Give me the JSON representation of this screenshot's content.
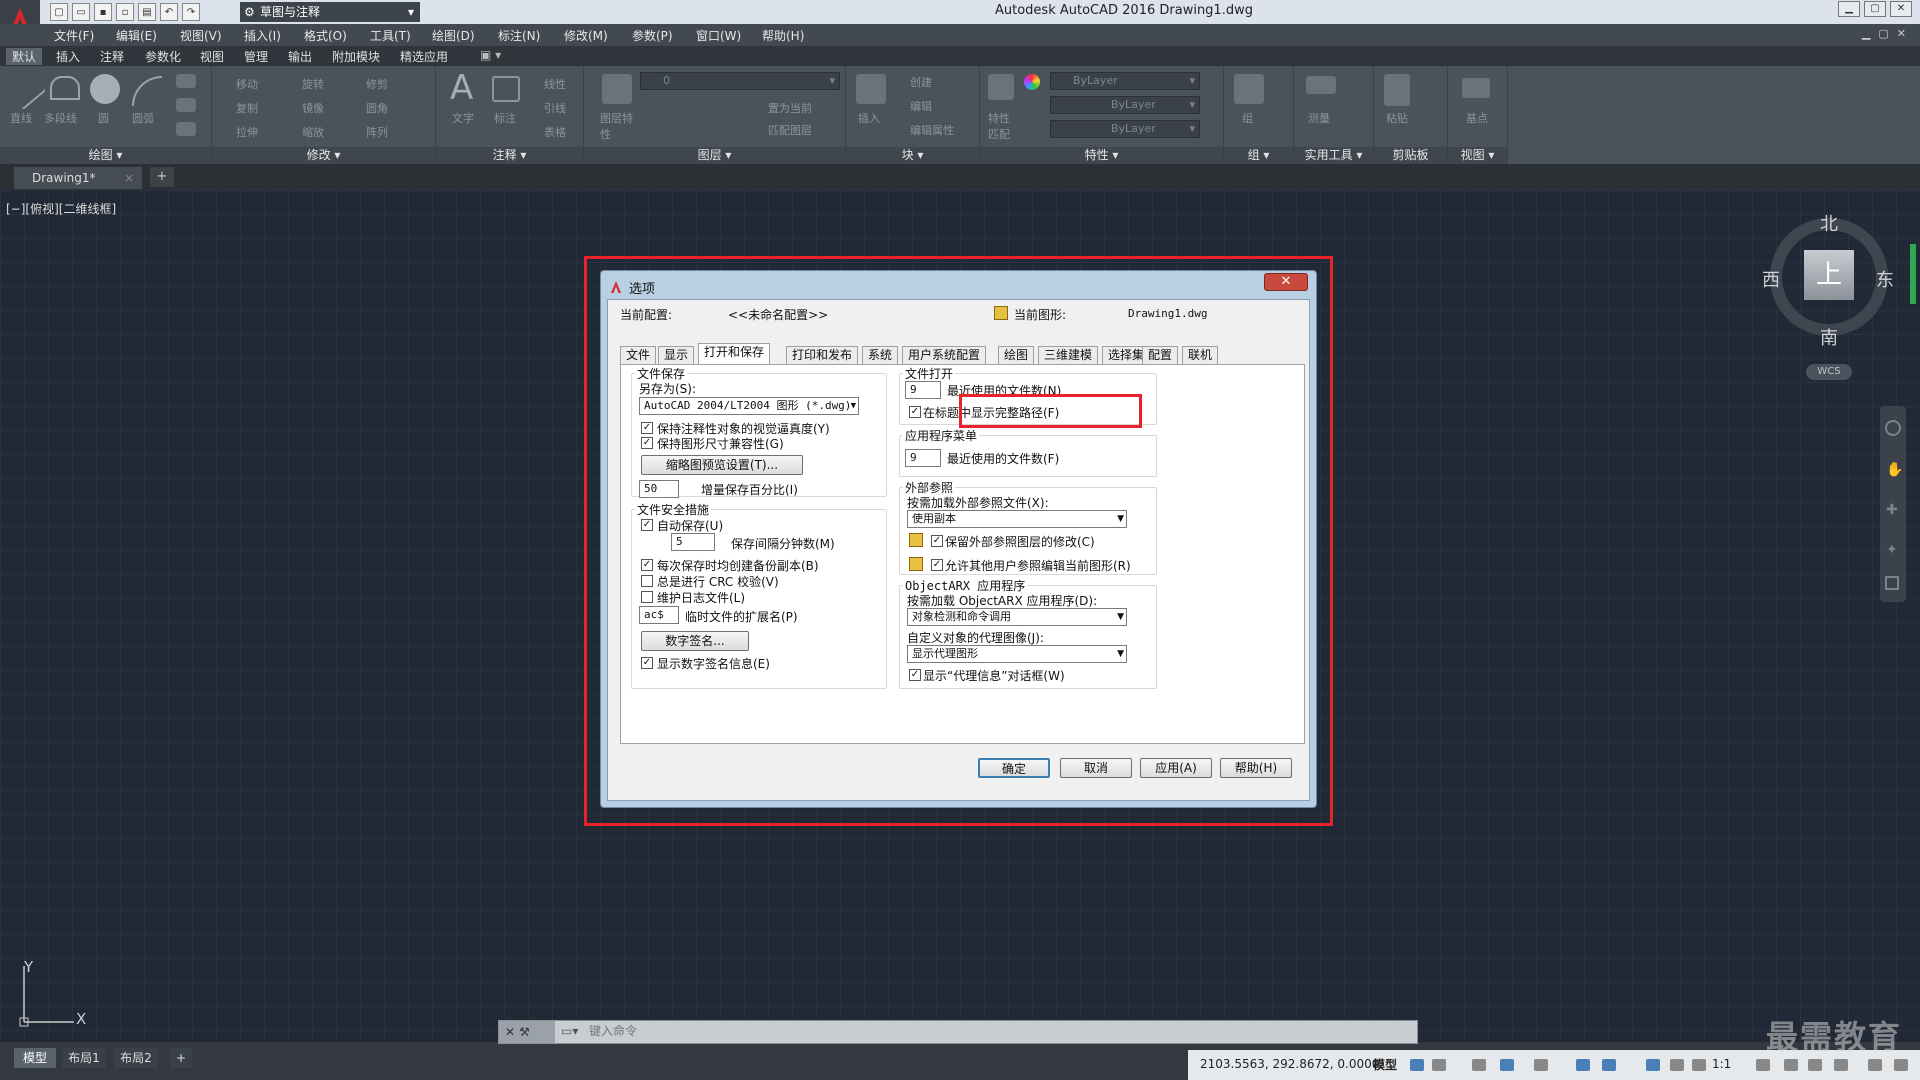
{
  "titlebar": {
    "workspace": "草图与注释",
    "app_title": "Autodesk AutoCAD 2016    Drawing1.dwg"
  },
  "menubar": [
    "文件(F)",
    "编辑(E)",
    "视图(V)",
    "插入(I)",
    "格式(O)",
    "工具(T)",
    "绘图(D)",
    "标注(N)",
    "修改(M)",
    "参数(P)",
    "窗口(W)",
    "帮助(H)"
  ],
  "ribbon_tabs": [
    "默认",
    "插入",
    "注释",
    "参数化",
    "视图",
    "管理",
    "输出",
    "附加模块",
    "精选应用"
  ],
  "ribbon": {
    "draw": {
      "title": "绘图",
      "tools": [
        "直线",
        "多段线",
        "圆",
        "圆弧"
      ]
    },
    "modify": {
      "title": "修改",
      "tools": [
        "移动",
        "旋转",
        "修剪",
        "复制",
        "镜像",
        "圆角",
        "拉伸",
        "缩放",
        "阵列"
      ]
    },
    "annotation": {
      "title": "注释",
      "tools": [
        "文字",
        "标注",
        "线性",
        "引线",
        "表格"
      ]
    },
    "layers": {
      "title": "图层",
      "current": "0",
      "tools": [
        "图层特性",
        "置为当前",
        "匹配图层"
      ]
    },
    "block": {
      "title": "块",
      "tools": [
        "插入",
        "创建",
        "编辑",
        "编辑属性"
      ]
    },
    "properties": {
      "title": "特性",
      "bylayer": [
        "ByLayer",
        "ByLayer",
        "ByLayer"
      ],
      "tools": [
        "特性匹配"
      ]
    },
    "groups": {
      "title": "组",
      "tools": [
        "组"
      ]
    },
    "utilities": {
      "title": "实用工具",
      "tools": [
        "测量"
      ]
    },
    "clipboard": {
      "title": "剪贴板",
      "tools": [
        "粘贴"
      ]
    },
    "view": {
      "title": "视图",
      "tools": [
        "基点"
      ]
    }
  },
  "doc_tab": {
    "name": "Drawing1*",
    "close": "×",
    "plus": "+"
  },
  "view_label": "[−][俯视][二维线框]",
  "viewcube": {
    "north": "北",
    "south": "南",
    "west": "西",
    "east": "东",
    "face": "上",
    "wcs": "WCS"
  },
  "ucs": {
    "x": "X",
    "y": "Y"
  },
  "dialog": {
    "title": "选项",
    "close": "✕",
    "current_profile_label": "当前配置:",
    "current_profile_value": "<<未命名配置>>",
    "current_drawing_label": "当前图形:",
    "current_drawing_value": "Drawing1.dwg",
    "tabs": [
      "文件",
      "显示",
      "打开和保存",
      "打印和发布",
      "系统",
      "用户系统配置",
      "绘图",
      "三维建模",
      "选择集",
      "配置",
      "联机"
    ],
    "file_save": {
      "title": "文件保存",
      "save_as_label": "另存为(S):",
      "save_as_value": "AutoCAD 2004/LT2004 图形 (*.dwg)",
      "opt1": "保持注释性对象的视觉逼真度(Y)",
      "opt2": "保持图形尺寸兼容性(G)",
      "thumb_btn": "缩略图预览设置(T)...",
      "incr_value": "50",
      "incr_label": "增量保存百分比(I)"
    },
    "file_safety": {
      "title": "文件安全措施",
      "autosave": "自动保存(U)",
      "interval_value": "5",
      "interval_label": "保存间隔分钟数(M)",
      "backup": "每次保存时均创建备份副本(B)",
      "crc": "总是进行 CRC 校验(V)",
      "log": "维护日志文件(L)",
      "temp_ext_value": "ac$",
      "temp_ext_label": "临时文件的扩展名(P)",
      "sig_btn": "数字签名...",
      "sig_show": "显示数字签名信息(E)"
    },
    "file_open": {
      "title": "文件打开",
      "recent_value": "9",
      "recent_label": "最近使用的文件数(N)",
      "fullpath": "在标题中显示完整路径(F)"
    },
    "app_menu": {
      "title": "应用程序菜单",
      "recent_value": "9",
      "recent_label": "最近使用的文件数(F)"
    },
    "xref": {
      "title": "外部参照",
      "demand_label": "按需加载外部参照文件(X):",
      "demand_value": "使用副本",
      "retain": "保留外部参照图层的修改(C)",
      "allow": "允许其他用户参照编辑当前图形(R)"
    },
    "objectarx": {
      "title": "ObjectARX 应用程序",
      "demand_label": "按需加载 ObjectARX 应用程序(D):",
      "demand_value": "对象检测和命令调用",
      "proxy_label": "自定义对象的代理图像(J):",
      "proxy_value": "显示代理图形",
      "proxy_info": "显示“代理信息”对话框(W)"
    },
    "buttons": {
      "ok": "确定",
      "cancel": "取消",
      "apply": "应用(A)",
      "help": "帮助(H)"
    }
  },
  "cmdline": {
    "placeholder": "键入命令"
  },
  "layout_tabs": [
    "模型",
    "布局1",
    "布局2",
    "+"
  ],
  "statusbar": {
    "coords": "2103.5563, 292.8672, 0.0000",
    "model": "模型",
    "scale": "1:1"
  },
  "watermark": "最需教育"
}
